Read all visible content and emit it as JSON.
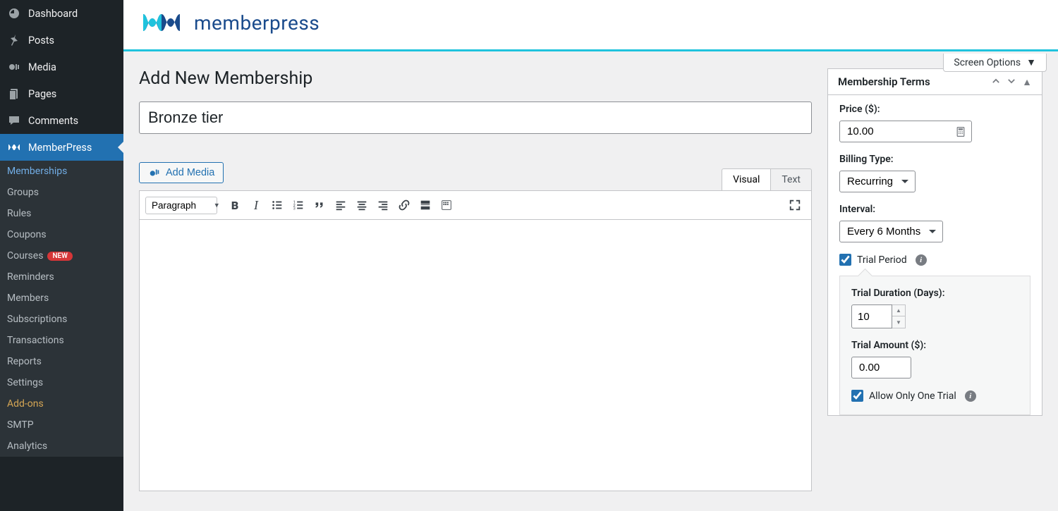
{
  "sidebar": {
    "dashboard": "Dashboard",
    "posts": "Posts",
    "media": "Media",
    "pages": "Pages",
    "comments": "Comments",
    "memberpress": "MemberPress",
    "sub": {
      "memberships": "Memberships",
      "groups": "Groups",
      "rules": "Rules",
      "coupons": "Coupons",
      "courses": "Courses",
      "courses_badge": "NEW",
      "reminders": "Reminders",
      "members": "Members",
      "subscriptions": "Subscriptions",
      "transactions": "Transactions",
      "reports": "Reports",
      "settings": "Settings",
      "addons": "Add-ons",
      "smtp": "SMTP",
      "analytics": "Analytics"
    }
  },
  "brand": {
    "text": "memberpress"
  },
  "screen_options": "Screen Options",
  "page": {
    "title": "Add New Membership"
  },
  "form": {
    "title_value": "Bronze tier"
  },
  "editor": {
    "add_media": "Add Media",
    "tab_visual": "Visual",
    "tab_text": "Text",
    "format": "Paragraph"
  },
  "metabox": {
    "title": "Membership Terms",
    "price_label": "Price ($):",
    "price_value": "10.00",
    "billing_label": "Billing Type:",
    "billing_value": "Recurring",
    "interval_label": "Interval:",
    "interval_value": "Every 6 Months",
    "trial_period": "Trial Period",
    "trial_duration_label": "Trial Duration (Days):",
    "trial_duration_value": "10",
    "trial_amount_label": "Trial Amount ($):",
    "trial_amount_value": "0.00",
    "allow_one_trial": "Allow Only One Trial"
  }
}
